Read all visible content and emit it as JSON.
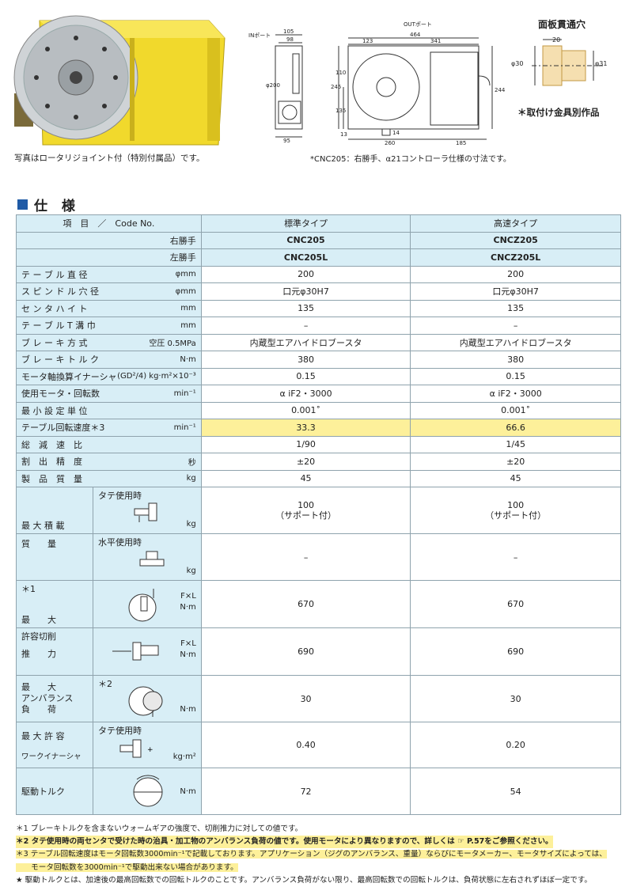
{
  "photo_caption": "写真はロータリジョイント付（特別付属品）です。",
  "drawing_note": "*CNC205：右勝手、α21コントローラ仕様の寸法です。",
  "panel": {
    "title": "面板貫通穴",
    "dim_top": "20",
    "dim_left": "φ30",
    "dim_right": "φ31",
    "note": "＊取付け金具別作品"
  },
  "drawing_labels": {
    "in_port": "INポート",
    "out_port": "OUTポート",
    "d105": "105",
    "d98": "98",
    "d464": "464",
    "d123": "123",
    "d341": "341",
    "d200": "φ200",
    "d245": "245",
    "d110": "110",
    "d135": "135",
    "d244": "244",
    "d95": "95",
    "d13": "13",
    "d14": "14",
    "d260": "260",
    "d185": "185"
  },
  "section_title": "仕 様",
  "table": {
    "header": {
      "item": "項　目　／　Code No.",
      "std": "標準タイプ",
      "fast": "高速タイプ"
    },
    "right_hand": {
      "label": "右勝手",
      "std": "CNC205",
      "fast": "CNCZ205"
    },
    "left_hand": {
      "label": "左勝手",
      "std": "CNC205L",
      "fast": "CNCZ205L"
    },
    "rows": [
      {
        "label": "テ ー ブ ル 直 径",
        "unit": "φmm",
        "std": "200",
        "fast": "200"
      },
      {
        "label": "ス ピ ン ド ル 穴 径",
        "unit": "φmm",
        "std": "口元φ30H7",
        "fast": "口元φ30H7"
      },
      {
        "label": "セ ン タ ハ イ ト",
        "unit": "mm",
        "std": "135",
        "fast": "135"
      },
      {
        "label": "テ ー ブ ル T 溝 巾",
        "unit": "mm",
        "std": "–",
        "fast": "–"
      },
      {
        "label": "ブ レ ー キ 方 式",
        "unit": "空圧 0.5MPa",
        "std": "内蔵型エアハイドロブースタ",
        "fast": "内蔵型エアハイドロブースタ"
      },
      {
        "label": "ブ レ ー キ ト ル ク",
        "unit": "N·m",
        "std": "380",
        "fast": "380"
      },
      {
        "label": "モータ軸換算イナーシャ",
        "unit": "(GD²/4) kg·m²×10⁻³",
        "std": "0.15",
        "fast": "0.15"
      },
      {
        "label": "使用モータ・回転数",
        "unit": "min⁻¹",
        "std": "α iF2・3000",
        "fast": "α iF2・3000"
      },
      {
        "label": "最 小 設 定 単 位",
        "unit": "",
        "std": "0.001˚",
        "fast": "0.001˚"
      },
      {
        "label": "テーブル回転速度＊3",
        "unit": "min⁻¹",
        "std": "33.3",
        "fast": "66.6"
      },
      {
        "label": "総　減　速　比",
        "unit": "",
        "std": "1/90",
        "fast": "1/45"
      },
      {
        "label": "割　出　精　度",
        "unit": "秒",
        "std": "±20",
        "fast": "±20"
      },
      {
        "label": "製　品　質　量",
        "unit": "kg",
        "std": "45",
        "fast": "45"
      }
    ],
    "max_load": {
      "group_label_1": "最 大 積 載",
      "group_label_2": "質　　量",
      "vertical": {
        "label": "タテ使用時",
        "unit": "kg",
        "std": "100\n（サポート付）",
        "fast": "100\n（サポート付）"
      },
      "horizontal": {
        "label": "水平使用時",
        "unit": "kg",
        "std": "–",
        "fast": "–"
      }
    },
    "max_cut": {
      "note": "＊1",
      "group_label_1": "最　　大",
      "group_label_2": "許容切削",
      "group_label_3": "推　　力",
      "row1": {
        "unit1": "F×L",
        "unit2": "N·m",
        "std": "670",
        "fast": "670"
      },
      "row2": {
        "unit1": "F×L",
        "unit2": "N·m",
        "std": "690",
        "fast": "690"
      }
    },
    "unbalance": {
      "note": "＊2",
      "label1": "最　　大",
      "label2": "アンバランス",
      "label3": "負　　荷",
      "unit": "N·m",
      "std": "30",
      "fast": "30"
    },
    "inertia": {
      "label1": "最 大 許 容",
      "label2": "ワークイナーシャ",
      "sub": "タテ使用時",
      "unit": "kg·m²",
      "std": "0.40",
      "fast": "0.20"
    },
    "drive_torque": {
      "label": "駆動トルク",
      "unit": "N·m",
      "std": "72",
      "fast": "54"
    }
  },
  "notes": [
    "＊1 ブレーキトルクを含まないウォームギアの強度で、切削推力に対しての値です。",
    "＊2 タテ使用時の両センタで受けた時の治具・加工物のアンバランス負荷の値です。使用モータにより異なりますので、詳しくは ☞ P.57をご参照ください。",
    "＊3 テーブル回転速度はモータ回転数3000min⁻¹で記載しております。アプリケーション（ジグのアンバランス、重量）ならびにモータメーカー、モータサイズによっては、",
    "　　モータ回転数を3000min⁻¹で駆動出来ない場合があります。",
    "★ 駆動トルクとは、加速後の最高回転数での回転トルクのことです。アンバランス負荷がない限り、最高回転数での回転トルクは、負荷状態に左右されずほぼ一定です。"
  ],
  "colors": {
    "header_blue": "#d8eef6",
    "highlight": "#fdf09a",
    "accent": "#1f5aa6",
    "body_yellow": "#f1d92c"
  }
}
